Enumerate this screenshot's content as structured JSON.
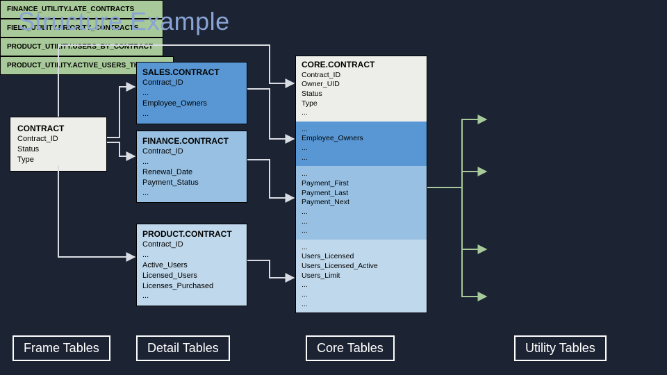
{
  "title": "Structure Example",
  "frame": {
    "title": "CONTRACT",
    "fields": [
      "Contract_ID",
      "Status",
      "Type"
    ]
  },
  "details": {
    "sales": {
      "title": "SALES.CONTRACT",
      "fields": [
        "Contract_ID",
        "...",
        "Employee_Owners",
        "..."
      ]
    },
    "finance": {
      "title": "FINANCE.CONTRACT",
      "fields": [
        "Contract_ID",
        "...",
        "Renewal_Date",
        "Payment_Status",
        "..."
      ]
    },
    "product": {
      "title": "PRODUCT.CONTRACT",
      "fields": [
        "Contract_ID",
        "...",
        "Active_Users",
        "Licensed_Users",
        "Licenses_Purchased",
        "..."
      ]
    }
  },
  "core": {
    "title": "CORE.CONTRACT",
    "head": [
      "Contract_ID",
      "Owner_UID",
      "Status",
      "Type",
      "..."
    ],
    "s2": [
      "...",
      "Employee_Owners",
      "...",
      "..."
    ],
    "s3": [
      "...",
      "Payment_First",
      "Payment_Last",
      "Payment_Next",
      "...",
      "...",
      "..."
    ],
    "s4": [
      "...",
      "Users_Licensed",
      "Users_Licensed_Active",
      "Users_Limit",
      "...",
      "...",
      "..."
    ]
  },
  "utility": {
    "u1": "FINANCE_UTILITY.LATE_CONTRACTS",
    "u2": "FIELD_UTILITY.PRIORITY_CONTRACTS",
    "u3": "PRODUCT_UTILITY.USERS_BY_CONTRACT",
    "u4": "PRODUCT_UTILITY.ACTIVE_USERS_THIS_MONTH"
  },
  "categories": {
    "frame": "Frame Tables",
    "detail": "Detail Tables",
    "core": "Core Tables",
    "utility": "Utility Tables"
  }
}
